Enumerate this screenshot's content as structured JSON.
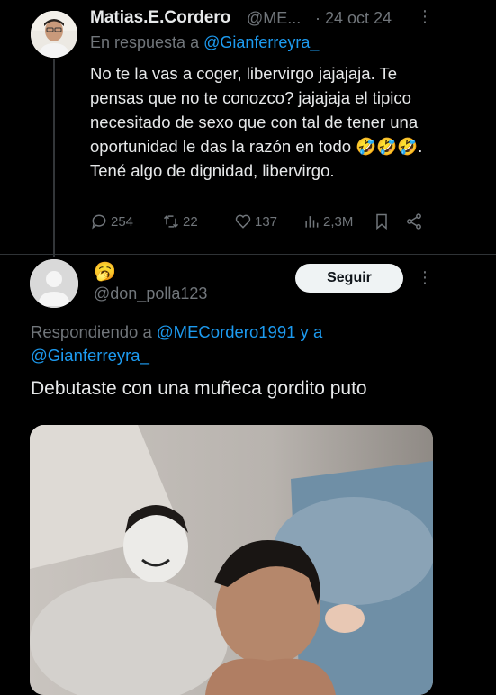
{
  "tweet1": {
    "author_name": "Matias.E.Cordero",
    "handle": "@ME...",
    "date": "· 24 oct 24",
    "more": "⋮",
    "reply_prefix": "En respuesta a ",
    "reply_handle": "@Gianferreyra_",
    "text": "No te la vas a coger, libervirgo jajajaja. Te pensas que no te conozco? jajajaja el tipico necesitado de sexo que con tal de tener una oportunidad le das la razón en todo 🤣🤣🤣. Tené algo de dignidad, libervirgo.",
    "stats": {
      "replies": "254",
      "retweets": "22",
      "likes": "137",
      "views": "2,3M"
    }
  },
  "tweet2": {
    "display_name": "🥱",
    "handle": "@don_polla123",
    "follow_label": "Seguir",
    "more": "⋮",
    "responding_prefix": "Respondiendo a ",
    "responding_handle_1": "@MECordero1991",
    "responding_and": " y a",
    "responding_handle_2": "@Gianferreyra_",
    "text": "Debutaste con una muñeca gordito puto"
  },
  "icons": {
    "reply": "speech-bubble-icon",
    "retweet": "retweet-icon",
    "like": "heart-icon",
    "views": "bar-chart-icon",
    "bookmark": "bookmark-icon",
    "share": "share-icon",
    "more": "more-icon"
  },
  "colors": {
    "background": "#000000",
    "text": "#e7e9ea",
    "muted": "#71767b",
    "link": "#1d9bf0",
    "follow_bg": "#eff3f4"
  }
}
